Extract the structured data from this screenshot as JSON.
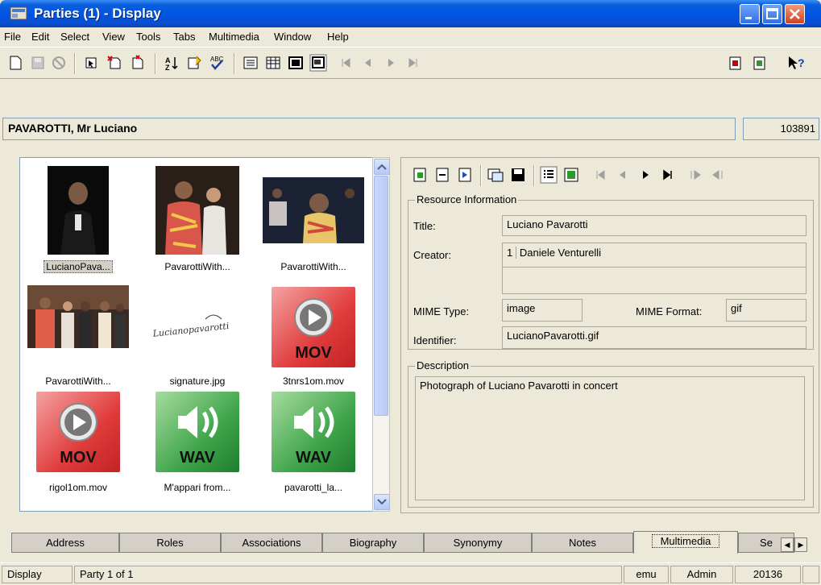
{
  "window": {
    "title": "Parties (1) - Display"
  },
  "menu": [
    "File",
    "Edit",
    "Select",
    "View",
    "Tools",
    "Tabs",
    "Multimedia",
    "Window",
    "Help"
  ],
  "record": {
    "name": "PAVAROTTI, Mr Luciano",
    "id": "103891"
  },
  "thumbnails": [
    {
      "caption": "LucianoPava...",
      "type": "photo",
      "selected": true
    },
    {
      "caption": "PavarottiWith...",
      "type": "photo"
    },
    {
      "caption": "PavarottiWith...",
      "type": "photo"
    },
    {
      "caption": "PavarottiWith...",
      "type": "photo"
    },
    {
      "caption": "signature.jpg",
      "type": "signature",
      "signature_text": "Lucianopavarotti"
    },
    {
      "caption": "3tnrs1om.mov",
      "type": "mov",
      "icon_label": "MOV"
    },
    {
      "caption": "rigol1om.mov",
      "type": "mov",
      "icon_label": "MOV"
    },
    {
      "caption": "M'appari from...",
      "type": "wav",
      "icon_label": "WAV"
    },
    {
      "caption": "pavarotti_la...",
      "type": "wav",
      "icon_label": "WAV"
    }
  ],
  "resource": {
    "group_label": "Resource Information",
    "title_label": "Title:",
    "title_value": "Luciano Pavarotti",
    "creator_label": "Creator:",
    "creator_index": "1",
    "creator_value": "Daniele Venturelli",
    "mime_type_label": "MIME Type:",
    "mime_type_value": "image",
    "mime_format_label": "MIME Format:",
    "mime_format_value": "gif",
    "identifier_label": "Identifier:",
    "identifier_value": "LucianoPavarotti.gif"
  },
  "description": {
    "group_label": "Description",
    "text": "Photograph of Luciano Pavarotti in concert"
  },
  "tabs": [
    {
      "label": "Address"
    },
    {
      "label": "Roles"
    },
    {
      "label": "Associations"
    },
    {
      "label": "Biography"
    },
    {
      "label": "Synonymy"
    },
    {
      "label": "Notes"
    },
    {
      "label": "Multimedia",
      "active": true
    },
    {
      "label": "Se"
    }
  ],
  "status": {
    "mode": "Display",
    "position": "Party 1 of 1",
    "module": "emu",
    "user": "Admin",
    "number": "20136"
  },
  "colors": {
    "titlebar": "#0054e3",
    "face": "#ece9d8",
    "mov": "#e03b3b",
    "wav": "#3fa54a"
  }
}
